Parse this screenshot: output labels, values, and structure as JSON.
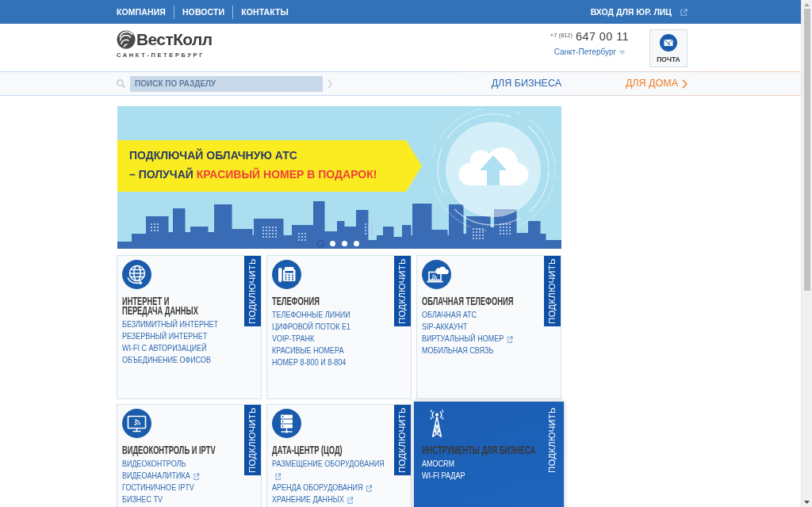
{
  "top_bar": {
    "links": [
      "КОМПАНИЯ",
      "НОВОСТИ",
      "КОНТАКТЫ"
    ],
    "login": {
      "label": "ВХОД ДЛЯ ЮР. ЛИЦ",
      "external": true
    }
  },
  "header": {
    "logo": {
      "name": "ВестКолл",
      "city": "САНКТ-ПЕТЕРБУРГ"
    },
    "phone": {
      "code": "+7 (812)",
      "number": "647 00 11"
    },
    "city_selector": "Санкт-Петербург",
    "mail_button": "ПОЧТА"
  },
  "section_bar": {
    "search": {
      "placeholder": "ПОИСК ПО РАЗДЕЛУ"
    },
    "sections": [
      {
        "label": "ДЛЯ БИЗНЕСА",
        "selected": true
      },
      {
        "label": "ДЛЯ ДОМА",
        "selected": false
      }
    ]
  },
  "banner": {
    "headline": {
      "line_1": "ПОДКЛЮЧАЙ ОБЛАЧНУЮ АТС",
      "line_2": "– ПОЛУЧАЙ",
      "highlight": "КРАСИВЫЙ НОМЕР В ПОДАРОК!"
    },
    "slides": [
      {
        "selected": true
      },
      {
        "selected": false
      },
      {
        "selected": false
      },
      {
        "selected": false
      }
    ]
  },
  "services": [
    {
      "title": "ИНТЕРНЕТ И\nПЕРЕДАЧА ДАННЫХ",
      "highlighted": false,
      "action": "ПОДКЛЮЧИТЬ",
      "links": [
        {
          "label": "БЕЗЛИМИТНЫЙ ИНТЕРНЕТ",
          "external": false
        },
        {
          "label": "РЕЗЕРВНЫЙ ИНТЕРНЕТ",
          "external": false
        },
        {
          "label": "WI-FI С АВТОРИЗАЦИЕЙ",
          "external": false
        },
        {
          "label": "ОБЪЕДИНЕНИЕ ОФИСОВ",
          "external": false
        }
      ]
    },
    {
      "title": "ТЕЛЕФОНИЯ",
      "highlighted": false,
      "action": "ПОДКЛЮЧИТЬ",
      "links": [
        {
          "label": "ТЕЛЕФОННЫЕ ЛИНИИ",
          "external": false
        },
        {
          "label": "ЦИФРОВОЙ ПОТОК E1",
          "external": false
        },
        {
          "label": "VOIP-ТРАНК",
          "external": false
        },
        {
          "label": "КРАСИВЫЕ НОМЕРА",
          "external": false
        },
        {
          "label": "НОМЕР 8-800 И 8-804",
          "external": false
        }
      ]
    },
    {
      "title": "ОБЛАЧНАЯ ТЕЛЕФОНИЯ",
      "highlighted": false,
      "action": "ПОДКЛЮЧИТЬ",
      "links": [
        {
          "label": "ОБЛАЧНАЯ АТС",
          "external": false
        },
        {
          "label": "SIP-АККАУНТ",
          "external": false
        },
        {
          "label": "ВИРТУАЛЬНЫЙ НОМЕР",
          "external": true
        },
        {
          "label": "МОБИЛЬНАЯ СВЯЗЬ",
          "external": false
        }
      ]
    },
    {
      "title": "ВИДЕОКОНТРОЛЬ И IPTV",
      "highlighted": false,
      "action": "ПОДКЛЮЧИТЬ",
      "links": [
        {
          "label": "ВИДЕОКОНТРОЛЬ",
          "external": false
        },
        {
          "label": "ВИДЕОАНАЛИТИКА",
          "external": true
        },
        {
          "label": "ГОСТИНИЧНОЕ IPTV",
          "external": false
        },
        {
          "label": "БИЗНЕС TV",
          "external": false
        }
      ]
    },
    {
      "title": "ДАТА-ЦЕНТР (ЦОД)",
      "highlighted": false,
      "action": "ПОДКЛЮЧИТЬ",
      "links": [
        {
          "label": "РАЗМЕЩЕНИЕ ОБОРУДОВАНИЯ",
          "external": true
        },
        {
          "label": "АРЕНДА ОБОРУДОВАНИЯ",
          "external": true
        },
        {
          "label": "ХРАНЕНИЕ ДАННЫХ",
          "external": true
        }
      ]
    },
    {
      "title": "ИНСТРУМЕНТЫ ДЛЯ БИЗНЕСА",
      "highlighted": true,
      "action": "ПОДКЛЮЧИТЬ",
      "links": [
        {
          "label": "AMOCRM",
          "external": false
        },
        {
          "label": "WI-FI РАДАР",
          "external": false
        }
      ]
    }
  ]
}
